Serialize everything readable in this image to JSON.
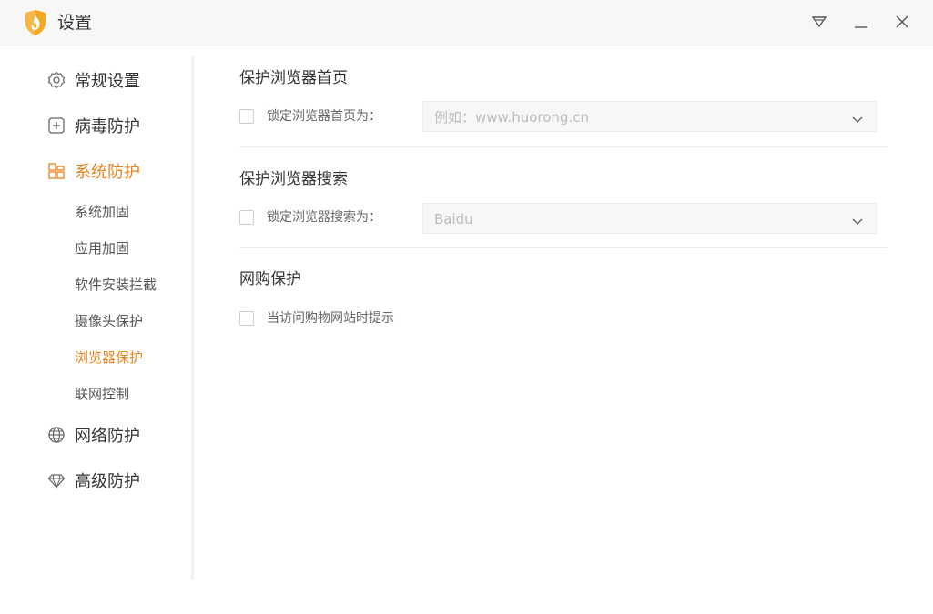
{
  "window": {
    "title": "设置",
    "logo_icon": "huorong-shield-flame-icon",
    "accent_color": "#e8841d"
  },
  "sidebar": {
    "items": [
      {
        "label": "常规设置",
        "icon": "gear-icon"
      },
      {
        "label": "病毒防护",
        "icon": "plus-square-icon"
      },
      {
        "label": "系统防护",
        "icon": "grid-icon",
        "active": true
      },
      {
        "label": "网络防护",
        "icon": "globe-icon"
      },
      {
        "label": "高级防护",
        "icon": "diamond-icon"
      }
    ],
    "sub_items": [
      {
        "label": "系统加固"
      },
      {
        "label": "应用加固"
      },
      {
        "label": "软件安装拦截"
      },
      {
        "label": "摄像头保护"
      },
      {
        "label": "浏览器保护",
        "active": true
      },
      {
        "label": "联网控制"
      }
    ]
  },
  "main": {
    "sections": [
      {
        "title": "保护浏览器首页",
        "checkbox_label": "锁定浏览器首页为：",
        "checked": false,
        "select_placeholder": "例如：www.huorong.cn"
      },
      {
        "title": "保护浏览器搜索",
        "checkbox_label": "锁定浏览器搜索为：",
        "checked": false,
        "select_value": "Baidu"
      },
      {
        "title": "网购保护",
        "checkbox_label": "当访问购物网站时提示",
        "checked": false
      }
    ]
  }
}
